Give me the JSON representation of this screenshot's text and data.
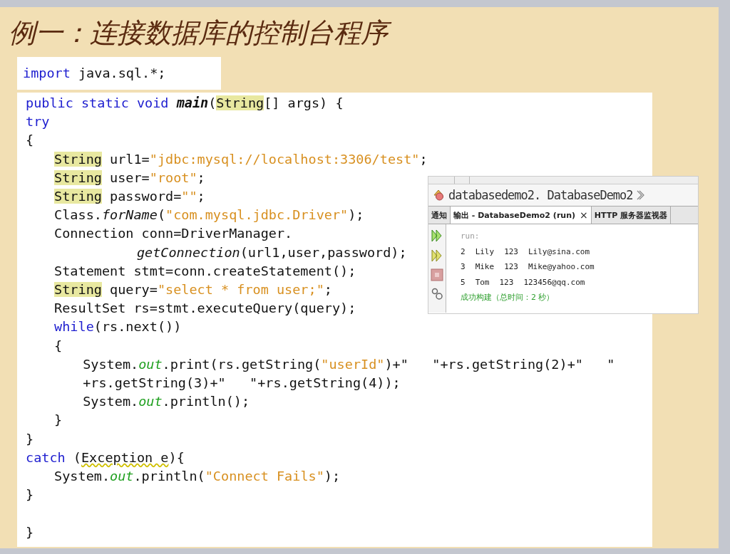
{
  "slide": {
    "title": "例一：连接数据库的控制台程序",
    "import_line": [
      {
        "kind": "keyword",
        "text": "import"
      },
      {
        "kind": "plain",
        "text": " java.sql.*;"
      }
    ],
    "code_lines": [
      {
        "tokens": [
          {
            "kind": "keyword",
            "text": "public static void "
          },
          {
            "kind": "bold_method",
            "text": "main"
          },
          {
            "kind": "plain",
            "text": "("
          },
          {
            "kind": "type",
            "text": "String"
          },
          {
            "kind": "plain",
            "text": "[] args) {"
          }
        ]
      },
      {
        "tokens": [
          {
            "kind": "keyword",
            "text": "try"
          }
        ]
      },
      {
        "tokens": [
          {
            "kind": "plain",
            "text": "{"
          }
        ],
        "children": [
          {
            "tokens": [
              {
                "kind": "type",
                "text": "String"
              },
              {
                "kind": "plain",
                "text": " url1="
              },
              {
                "kind": "string",
                "text": "\"jdbc:mysql://localhost:3306/test\""
              },
              {
                "kind": "plain",
                "text": ";"
              }
            ]
          },
          {
            "tokens": [
              {
                "kind": "type",
                "text": "String"
              },
              {
                "kind": "plain",
                "text": " user="
              },
              {
                "kind": "string",
                "text": "\"root\""
              },
              {
                "kind": "plain",
                "text": ";"
              }
            ]
          },
          {
            "tokens": [
              {
                "kind": "type",
                "text": "String"
              },
              {
                "kind": "plain",
                "text": " password="
              },
              {
                "kind": "string",
                "text": "\"\""
              },
              {
                "kind": "plain",
                "text": ";"
              }
            ]
          },
          {
            "tokens": [
              {
                "kind": "plain",
                "text": "Class."
              },
              {
                "kind": "static_method",
                "text": "forName"
              },
              {
                "kind": "plain",
                "text": "("
              },
              {
                "kind": "string",
                "text": "\"com.mysql.jdbc.Driver\""
              },
              {
                "kind": "plain",
                "text": ");"
              }
            ]
          },
          {
            "tokens": [
              {
                "kind": "plain",
                "text": "Connection conn=DriverManager."
              }
            ]
          },
          {
            "kind": "continuation",
            "tokens": [
              {
                "kind": "static_method",
                "text": "getConnection"
              },
              {
                "kind": "plain",
                "text": "(url1,user,password);"
              }
            ]
          },
          {
            "tokens": [
              {
                "kind": "plain",
                "text": "Statement stmt=conn.createStatement();"
              }
            ]
          },
          {
            "tokens": [
              {
                "kind": "type",
                "text": "String"
              },
              {
                "kind": "plain",
                "text": " query="
              },
              {
                "kind": "string",
                "text": "\"select * from user;\""
              },
              {
                "kind": "plain",
                "text": ";"
              }
            ]
          },
          {
            "tokens": [
              {
                "kind": "plain",
                "text": "ResultSet rs=stmt.executeQuery(query);"
              }
            ]
          },
          {
            "tokens": [
              {
                "kind": "keyword",
                "text": "while"
              },
              {
                "kind": "plain",
                "text": "(rs.next())"
              }
            ]
          },
          {
            "tokens": [
              {
                "kind": "plain",
                "text": "{"
              }
            ],
            "children": [
              {
                "tokens": [
                  {
                    "kind": "plain",
                    "text": "System."
                  },
                  {
                    "kind": "field",
                    "text": "out"
                  },
                  {
                    "kind": "plain",
                    "text": ".print(rs.getString("
                  },
                  {
                    "kind": "string",
                    "text": "\"userId\""
                  },
                  {
                    "kind": "plain",
                    "text": ")+\"   \"+rs.getString(2)+\"   \""
                  }
                ]
              },
              {
                "tokens": [
                  {
                    "kind": "plain",
                    "text": "+rs.getString(3)+\"   \"+rs.getString(4));"
                  }
                ]
              },
              {
                "tokens": [
                  {
                    "kind": "plain",
                    "text": "System."
                  },
                  {
                    "kind": "field",
                    "text": "out"
                  },
                  {
                    "kind": "plain",
                    "text": ".println();"
                  }
                ]
              }
            ]
          },
          {
            "tokens": [
              {
                "kind": "plain",
                "text": "}"
              }
            ]
          }
        ]
      },
      {
        "tokens": [
          {
            "kind": "plain",
            "text": "}"
          }
        ]
      },
      {
        "tokens": [
          {
            "kind": "keyword",
            "text": "catch"
          },
          {
            "kind": "plain",
            "text": " ("
          },
          {
            "kind": "warning",
            "text": "Exception e"
          },
          {
            "kind": "plain",
            "text": "){"
          }
        ],
        "children": [
          {
            "tokens": [
              {
                "kind": "plain",
                "text": "System."
              },
              {
                "kind": "field",
                "text": "out"
              },
              {
                "kind": "plain",
                "text": ".println("
              },
              {
                "kind": "string",
                "text": "\"Connect Fails\""
              },
              {
                "kind": "plain",
                "text": ");"
              }
            ]
          }
        ]
      },
      {
        "tokens": [
          {
            "kind": "plain",
            "text": "}"
          }
        ]
      },
      {
        "space_before": true,
        "tokens": [
          {
            "kind": "plain",
            "text": "}"
          }
        ]
      }
    ],
    "output_window": {
      "breadcrumb": "databasedemo2. DatabaseDemo2",
      "tabs": [
        {
          "label": "通知",
          "selected": false,
          "closable": false
        },
        {
          "label": "输出 - DatabaseDemo2 (run)",
          "selected": true,
          "closable": true
        },
        {
          "label": "HTTP 服务器监视器",
          "selected": false,
          "closable": false
        }
      ],
      "close_glyph": "×",
      "lines": [
        {
          "kind": "muted",
          "cells": [
            "run:"
          ]
        },
        {
          "kind": "data",
          "cells": [
            "2",
            "Lily",
            "123",
            "Lily@sina.com"
          ]
        },
        {
          "kind": "data",
          "cells": [
            "3",
            "Mike",
            "123",
            "Mike@yahoo.com"
          ]
        },
        {
          "kind": "data",
          "cells": [
            "5",
            "Tom",
            "123",
            "123456@qq.com"
          ]
        },
        {
          "kind": "success",
          "cells": [
            "成功构建（总时间：2 秒）"
          ]
        }
      ]
    }
  }
}
